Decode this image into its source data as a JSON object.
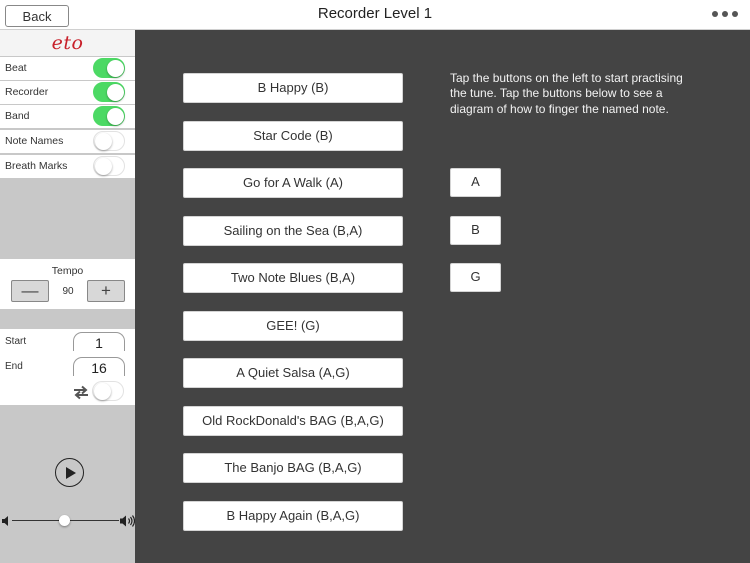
{
  "header": {
    "back_label": "Back",
    "title": "Recorder Level 1"
  },
  "sidebar": {
    "brand": "eto",
    "options": [
      {
        "label": "Beat",
        "on": true
      },
      {
        "label": "Recorder",
        "on": true
      },
      {
        "label": "Band",
        "on": true
      },
      {
        "label": "Note Names",
        "on": false
      },
      {
        "label": "Breath Marks",
        "on": false
      }
    ],
    "tempo": {
      "label": "Tempo",
      "value": "90",
      "minus": "—",
      "plus": "+"
    },
    "range": {
      "start_label": "Start",
      "start_value": "1",
      "end_label": "End",
      "end_value": "16",
      "loop_on": false
    }
  },
  "main": {
    "tunes": [
      "B Happy (B)",
      "Star Code (B)",
      "Go for A Walk (A)",
      "Sailing on the Sea (B,A)",
      "Two Note Blues (B,A)",
      "GEE! (G)",
      "A Quiet Salsa (A,G)",
      "Old RockDonald's BAG (B,A,G)",
      "The Banjo BAG (B,A,G)",
      "B Happy Again (B,A,G)"
    ],
    "instructions": "Tap the buttons on the left to start practising the tune. Tap the buttons below to see a diagram of how to finger the named note.",
    "notes": [
      "A",
      "B",
      "G"
    ]
  },
  "colors": {
    "toggle_on": "#4cd964",
    "main_bg": "#444444",
    "brand": "#c8202a"
  }
}
